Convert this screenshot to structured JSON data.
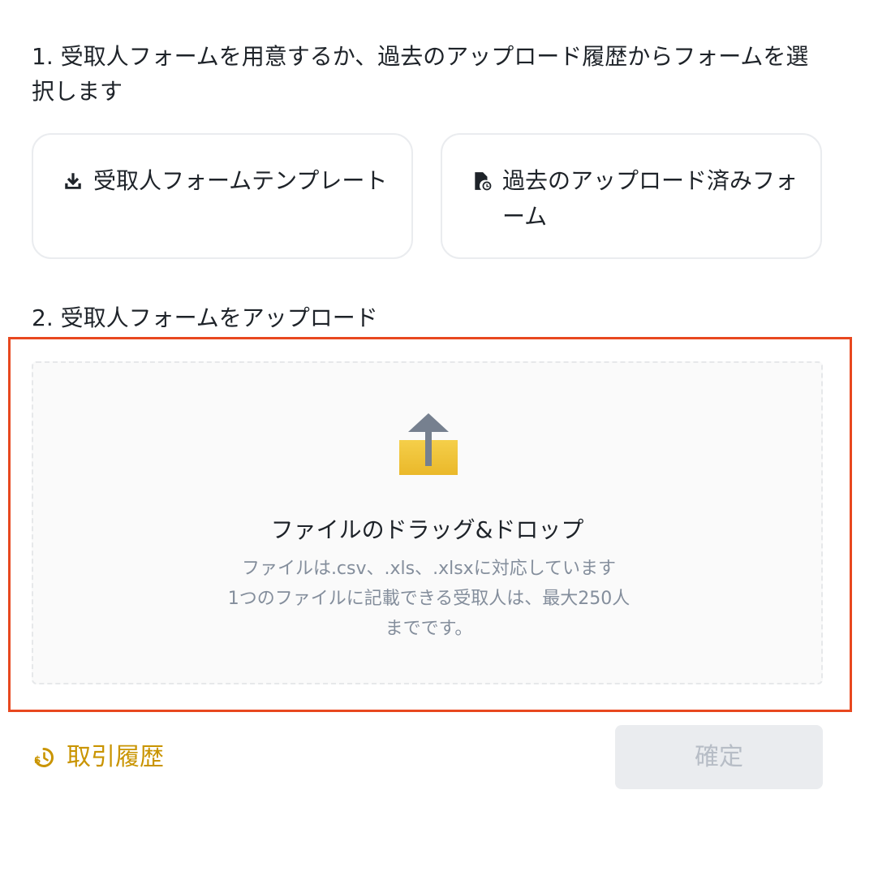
{
  "step1": {
    "title": "1. 受取人フォームを用意するか、過去のアップロード履歴からフォームを選択します"
  },
  "options": {
    "template": {
      "label": "受取人フォームテンプレート",
      "icon": "download-icon"
    },
    "history": {
      "label": "過去のアップロード済みフォーム",
      "icon": "file-history-icon"
    }
  },
  "step2": {
    "title": "2. 受取人フォームをアップロード"
  },
  "dropzone": {
    "icon": "upload-folder-icon",
    "title": "ファイルのドラッグ&ドロップ",
    "formats": "ファイルは.csv、.xls、.xlsxに対応しています",
    "limit_line1": "1つのファイルに記載できる受取人は、最大250人",
    "limit_line2": "までです。"
  },
  "footer": {
    "history_link": "取引履歴",
    "history_icon": "transaction-history-icon",
    "confirm_label": "確定"
  },
  "colors": {
    "text_primary": "#1e2329",
    "text_secondary": "#848e9c",
    "accent_gold": "#c99400",
    "highlight_red": "#e8481f",
    "button_disabled_bg": "#eaecef",
    "button_disabled_text": "#b7bdc6",
    "folder_yellow": "#f0c43c",
    "arrow_gray": "#76808f"
  }
}
